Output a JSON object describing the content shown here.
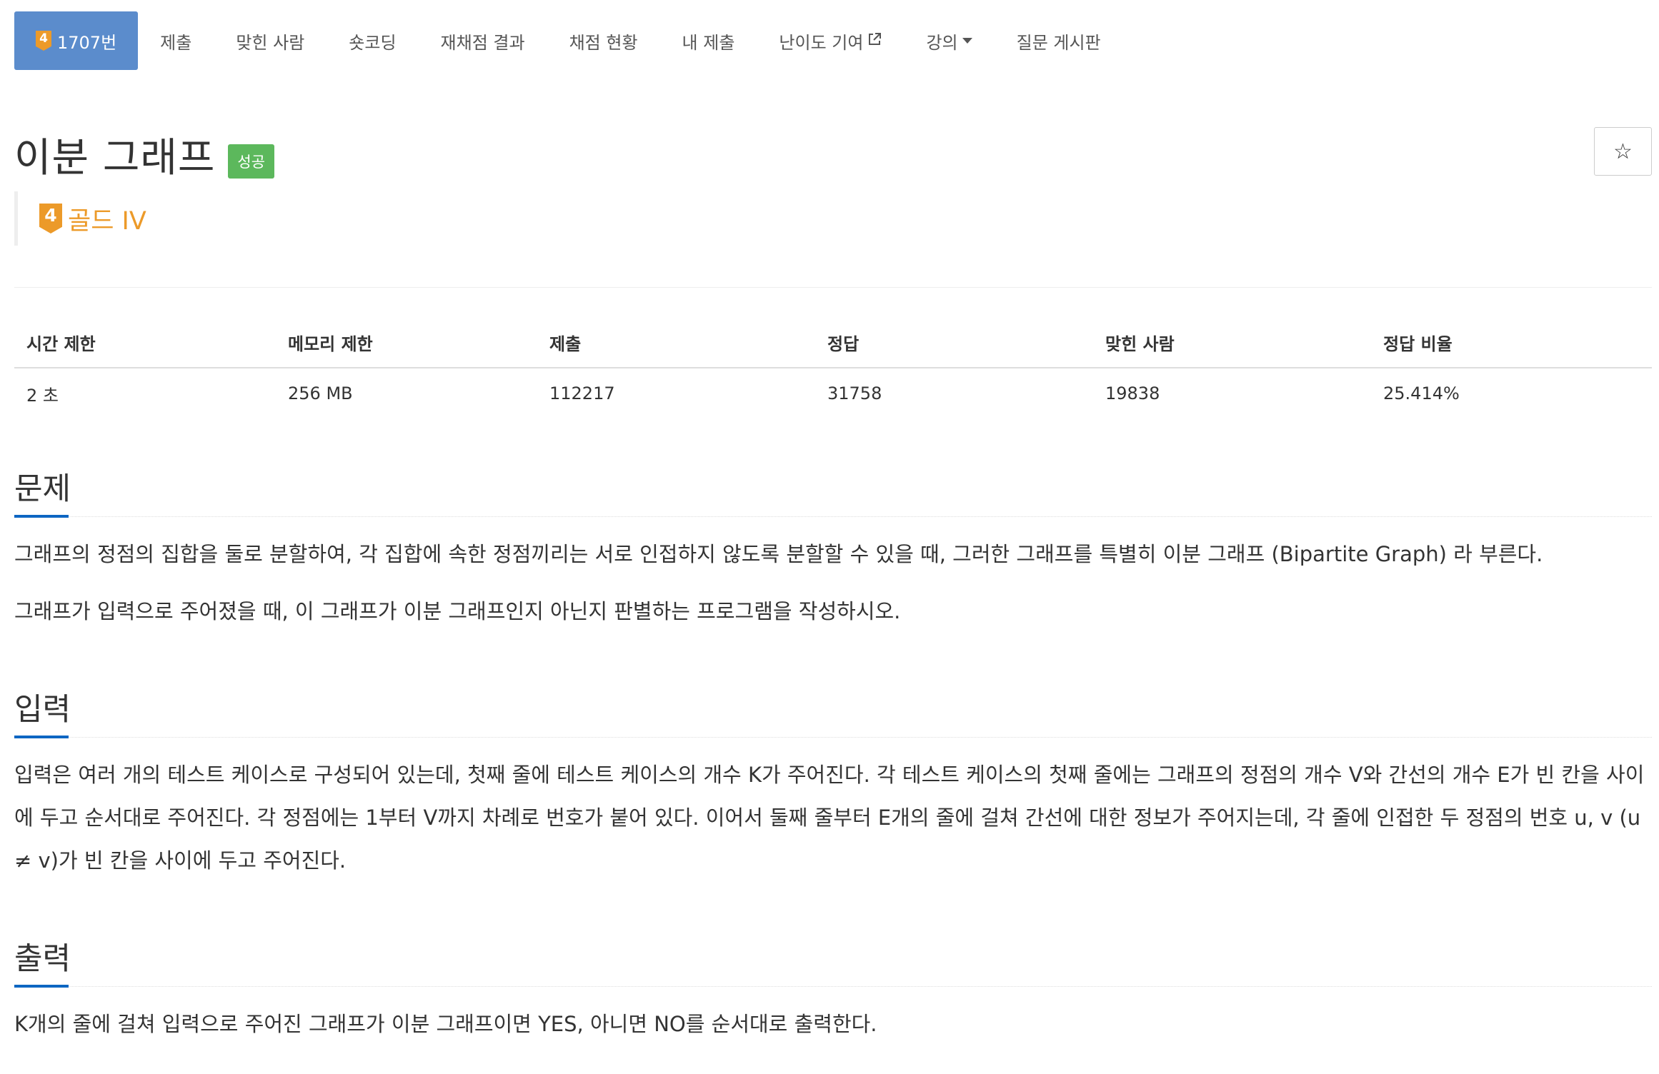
{
  "nav": {
    "items": [
      {
        "badge": "4",
        "label": "1707번",
        "active": true
      },
      {
        "label": "제출"
      },
      {
        "label": "맞힌 사람"
      },
      {
        "label": "숏코딩"
      },
      {
        "label": "재채점 결과"
      },
      {
        "label": "채점 현황"
      },
      {
        "label": "내 제출"
      },
      {
        "label": "난이도 기여",
        "icon": "external-link-icon"
      },
      {
        "label": "강의",
        "icon": "caret-down-icon"
      },
      {
        "label": "질문 게시판"
      }
    ]
  },
  "problem": {
    "title": "이분 그래프",
    "status_label": "성공",
    "star_icon": "☆",
    "tier_number": "4",
    "tier_label": "골드 IV",
    "tier_color": "#ec9a29"
  },
  "info_table": {
    "headers": [
      "시간 제한",
      "메모리 제한",
      "제출",
      "정답",
      "맞힌 사람",
      "정답 비율"
    ],
    "values": [
      "2 초",
      "256 MB",
      "112217",
      "31758",
      "19838",
      "25.414%"
    ]
  },
  "sections": {
    "description": {
      "title": "문제",
      "paragraphs": [
        "그래프의 정점의 집합을 둘로 분할하여, 각 집합에 속한 정점끼리는 서로 인접하지 않도록 분할할 수 있을 때, 그러한 그래프를 특별히 이분 그래프 (Bipartite Graph) 라 부른다.",
        "그래프가 입력으로 주어졌을 때, 이 그래프가 이분 그래프인지 아닌지 판별하는 프로그램을 작성하시오."
      ]
    },
    "input": {
      "title": "입력",
      "paragraphs": [
        "입력은 여러 개의 테스트 케이스로 구성되어 있는데, 첫째 줄에 테스트 케이스의 개수 K가 주어진다. 각 테스트 케이스의 첫째 줄에는 그래프의 정점의 개수 V와 간선의 개수 E가 빈 칸을 사이에 두고 순서대로 주어진다. 각 정점에는 1부터 V까지 차례로 번호가 붙어 있다. 이어서 둘째 줄부터 E개의 줄에 걸쳐 간선에 대한 정보가 주어지는데, 각 줄에 인접한 두 정점의 번호 u, v (u ≠ v)가 빈 칸을 사이에 두고 주어진다."
      ]
    },
    "output": {
      "title": "출력",
      "paragraphs": [
        "K개의 줄에 걸쳐 입력으로 주어진 그래프가 이분 그래프이면 YES, 아니면 NO를 순서대로 출력한다."
      ]
    }
  },
  "colors": {
    "nav_active": "#5b8ccc",
    "success": "#5cb85c",
    "section_underline": "#0d66c2"
  }
}
